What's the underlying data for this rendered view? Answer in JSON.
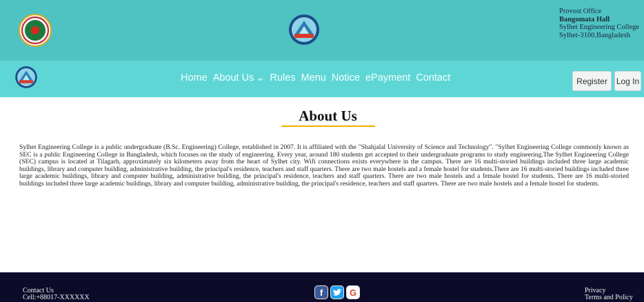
{
  "header": {
    "office_line1": "Provost Office",
    "office_name": "Bangomata Hall",
    "office_college": "Sylhet Engineering College",
    "office_address": "Sylhet-3100,Bangladesh",
    "gov_logo_icon": "bangladesh-govt-seal-icon",
    "hall_logo_icon": "hall-emblem-icon"
  },
  "nav": {
    "logo_icon": "hall-emblem-icon",
    "links": [
      "Home",
      "About Us",
      "Rules",
      "Menu",
      "Notice",
      "ePayment",
      "Contact"
    ],
    "register_label": "Register",
    "login_label": "Log In"
  },
  "main": {
    "title": "About Us",
    "text": "Sylhet Engineering College is a public undergraduate (B.Sc. Engineering) College, established in 2007. It is affiliated with the \"Shahjalal University of Science and Technology\". \"Sylhet Engineering College commonly known as SEC is a public Engineering College in Bangladesh, which focuses on the study of engineering. Every year, around 180 students get accepted to their undergraduate programs to study engineering.The Sylhet Engineering College (SEC) campus is located at Tilagarh, approximately six kilometers away from the heart of Sylhet city. Wifi connections exists everywhere in the campus. There are 16 multi-storied buildings included three large academic buildings, library and computer building, administrative building, the principal's residence, teachers and staff quarters. There are two male hostels and a female hostel for students.There are 16 multi-storied buildings included three large academic buildings, library and computer building, administrative building, the principal's residence, teachers and staff quarters. There are two male hostels and a female hostel for students. There are 16 multi-storied buildings included three large academic buildings, library and computer building, administrative building, the principal's residence, teachers and staff quarters. There are two male hostels and a female hostel for students."
  },
  "footer": {
    "contact_title": "Contact Us",
    "contact_cell": "Cell:+88017-XXXXXX",
    "privacy": "Privacy",
    "terms": "Terms and Policy",
    "social": {
      "facebook_icon": "facebook-icon",
      "twitter_icon": "twitter-icon",
      "google_icon": "google-icon"
    }
  },
  "colors": {
    "topbar": "#4fc2c2",
    "navbar": "#5fd6d6",
    "footer": "#0c0c2a",
    "title_underline": "#f0b000"
  }
}
